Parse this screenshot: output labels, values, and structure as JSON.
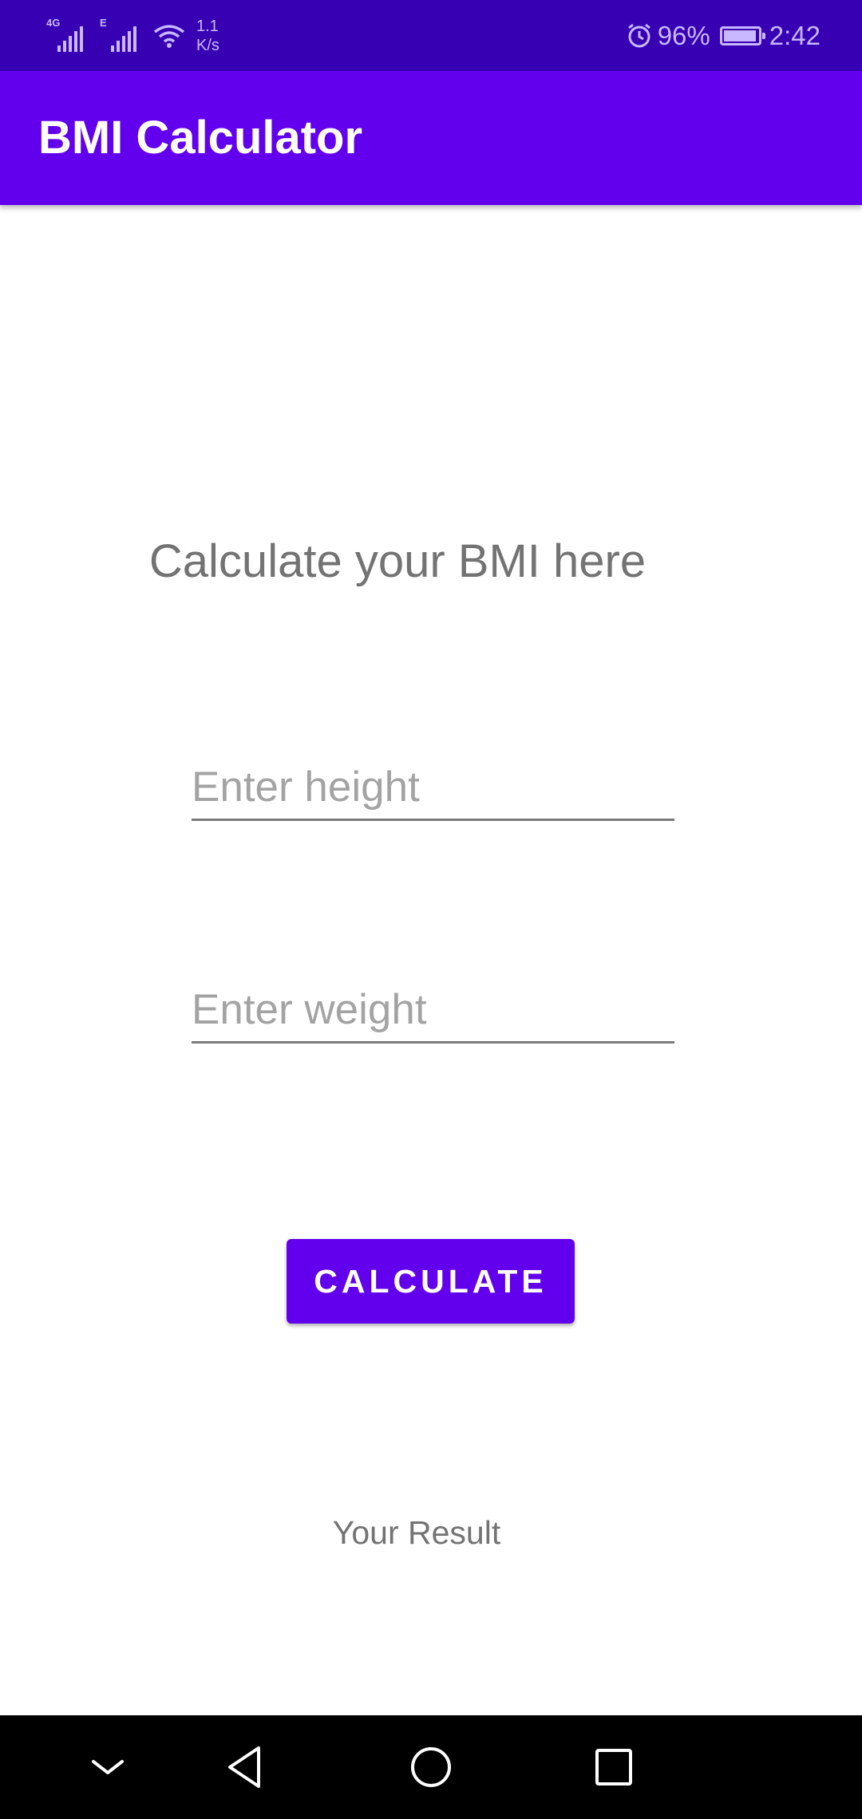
{
  "status_bar": {
    "network_1": "4G",
    "network_2": "E",
    "speed_value": "1.1",
    "speed_unit": "K/s",
    "battery_percent": "96%",
    "battery_level": 0.96,
    "time": "2:42",
    "icons": [
      "signal-icon",
      "wifi-icon",
      "alarm-icon",
      "battery-icon"
    ]
  },
  "app_bar": {
    "title": "BMI Calculator"
  },
  "main": {
    "heading": "Calculate your BMI here",
    "height_input": {
      "placeholder": "Enter height",
      "value": ""
    },
    "weight_input": {
      "placeholder": "Enter weight",
      "value": ""
    },
    "calculate_label": "CALCULATE",
    "result_text": "Your Result"
  },
  "nav_bar": {
    "icons": [
      "chevron-down-icon",
      "back-icon",
      "home-icon",
      "recents-icon"
    ]
  },
  "colors": {
    "status_bar": "#3700b3",
    "primary": "#6200ee",
    "text_gray": "#737373",
    "nav_bar": "#000000"
  }
}
